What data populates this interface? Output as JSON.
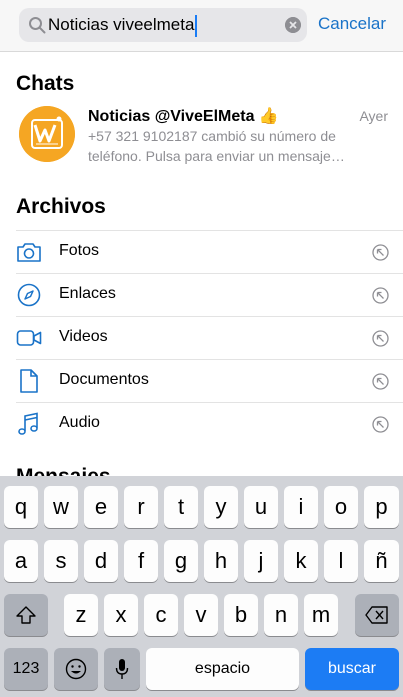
{
  "search": {
    "value": "Noticias viveelmeta",
    "cancel_label": "Cancelar"
  },
  "chats": {
    "title": "Chats",
    "items": [
      {
        "name": "Noticias @ViveElMeta 👍",
        "time": "Ayer",
        "preview": "+57 321 9102187 cambió su número de teléfono. Pulsa para enviar un mensaje…"
      }
    ]
  },
  "archivos": {
    "title": "Archivos",
    "items": [
      {
        "label": "Fotos",
        "icon": "camera-icon"
      },
      {
        "label": "Enlaces",
        "icon": "compass-icon"
      },
      {
        "label": "Videos",
        "icon": "video-icon"
      },
      {
        "label": "Documentos",
        "icon": "document-icon"
      },
      {
        "label": "Audio",
        "icon": "music-note-icon"
      }
    ]
  },
  "mensajes": {
    "title": "Mensajes"
  },
  "keyboard": {
    "row1": [
      "q",
      "w",
      "e",
      "r",
      "t",
      "y",
      "u",
      "i",
      "o",
      "p"
    ],
    "row2": [
      "a",
      "s",
      "d",
      "f",
      "g",
      "h",
      "j",
      "k",
      "l",
      "ñ"
    ],
    "row3": [
      "z",
      "x",
      "c",
      "v",
      "b",
      "n",
      "m"
    ],
    "numbers_label": "123",
    "space_label": "espacio",
    "search_label": "buscar"
  },
  "colors": {
    "accent": "#1a73c8",
    "avatar_bg": "#f5a623",
    "search_key": "#1c7cf4",
    "keyboard_bg": "#d1d3d8"
  }
}
